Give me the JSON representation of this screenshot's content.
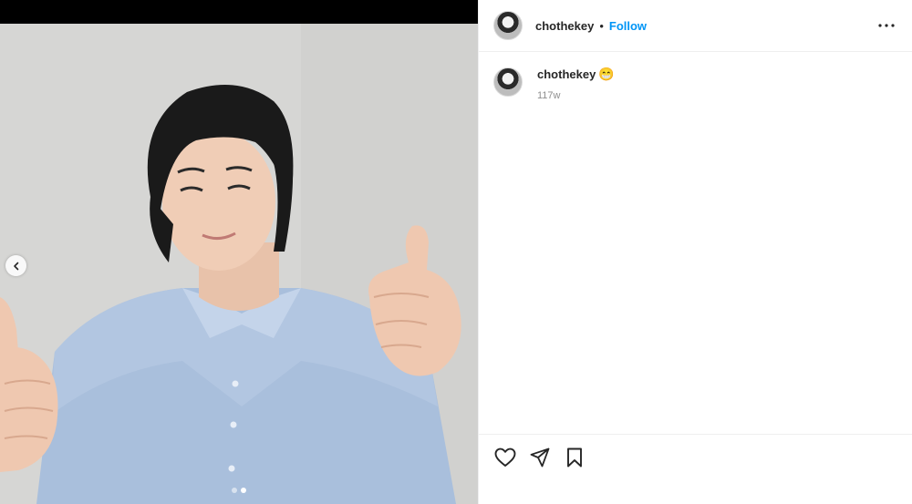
{
  "post": {
    "username": "chothekey",
    "separator": "•",
    "follow_label": "Follow",
    "caption_emoji": "😁",
    "timestamp": "117w"
  },
  "carousel": {
    "slides": 2,
    "active_index": 1
  },
  "icons": {
    "more": "more-options-icon",
    "like": "heart-icon",
    "share": "paper-plane-icon",
    "save": "bookmark-icon",
    "prev": "chevron-left-icon"
  },
  "colors": {
    "accent": "#0095f6",
    "secondary_text": "#8e8e8e",
    "divider": "#efefef"
  }
}
